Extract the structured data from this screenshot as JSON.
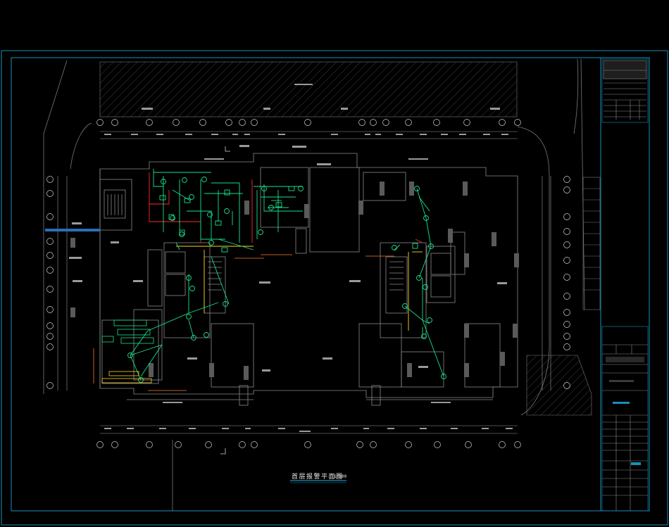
{
  "drawing": {
    "title": "首层报警平面图",
    "scale": "1:100"
  },
  "colors": {
    "background": "#000000",
    "frame": "#1a8fb8",
    "linework": "#9a9a9a",
    "alarm_wiring": "#19e08a",
    "fire_wiring": "#ff2a2a",
    "power_wiring": "#ffd21a",
    "device": "#19e08a",
    "callout": "#ff7a2a",
    "label": "#d8d8d8"
  },
  "icons": [
    "smoke-detector-icon",
    "manual-alarm-button-icon",
    "fire-hydrant-button-icon",
    "module-icon",
    "grid-axis-bubble-icon",
    "section-mark-icon"
  ]
}
